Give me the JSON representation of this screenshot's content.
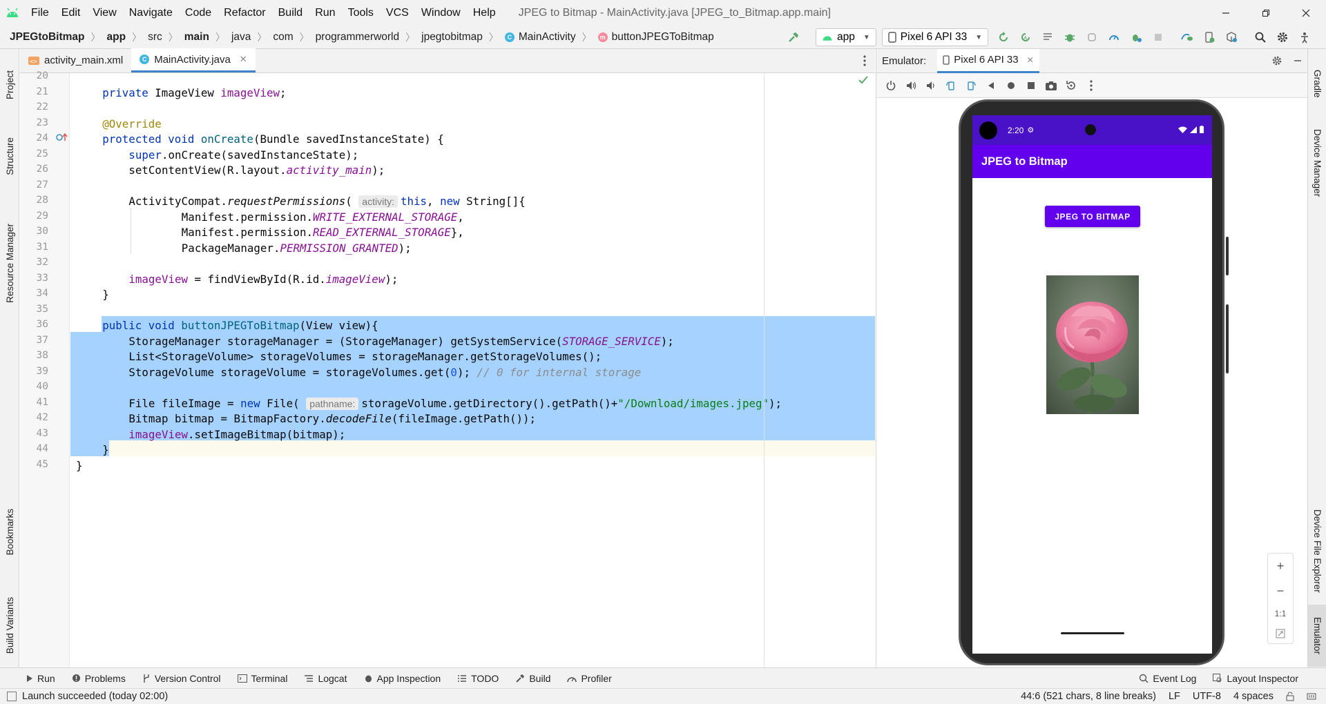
{
  "menubar": {
    "items": [
      "File",
      "Edit",
      "View",
      "Navigate",
      "Code",
      "Refactor",
      "Build",
      "Run",
      "Tools",
      "VCS",
      "Window",
      "Help"
    ],
    "window_title": "JPEG to Bitmap - MainActivity.java [JPEG_to_Bitmap.app.main]"
  },
  "breadcrumbs": [
    "JPEGtoBitmap",
    "app",
    "src",
    "main",
    "java",
    "com",
    "programmerworld",
    "jpegtobitmap",
    "MainActivity",
    "buttonJPEGToBitmap"
  ],
  "toolbar": {
    "run_config": "app",
    "device": "Pixel 6 API 33"
  },
  "left_tabs": [
    "Project",
    "Structure",
    "Resource Manager",
    "Bookmarks",
    "Build Variants"
  ],
  "right_tabs": [
    "Gradle",
    "Device Manager",
    "Device File Explorer",
    "Emulator"
  ],
  "editor_tabs": [
    {
      "label": "activity_main.xml",
      "icon": "xml-file-icon"
    },
    {
      "label": "MainActivity.java",
      "icon": "java-class-icon"
    }
  ],
  "line_numbers": [
    "20",
    "21",
    "22",
    "23",
    "24",
    "25",
    "26",
    "27",
    "28",
    "29",
    "30",
    "31",
    "32",
    "33",
    "34",
    "35",
    "36",
    "37",
    "38",
    "39",
    "40",
    "41",
    "42",
    "43",
    "44",
    "45"
  ],
  "code_hints": {
    "activity": "activity:",
    "pathname": "pathname:"
  },
  "emulator": {
    "label": "Emulator:",
    "tab": "Pixel 6 API 33",
    "phone_time": "2:20",
    "app_title": "JPEG to Bitmap",
    "button_label": "JPEG TO BITMAP",
    "zoom_label": "1:1"
  },
  "bottom_tools": [
    "Run",
    "Problems",
    "Version Control",
    "Terminal",
    "Logcat",
    "App Inspection",
    "TODO",
    "Build",
    "Profiler"
  ],
  "bottom_right_tools": [
    "Event Log",
    "Layout Inspector"
  ],
  "status": {
    "message": "Launch succeeded (today 02:00)",
    "position": "44:6 (521 chars, 8 line breaks)",
    "line_sep": "LF",
    "encoding": "UTF-8",
    "indent": "4 spaces"
  },
  "colors": {
    "accent": "#4083c9",
    "selection": "#a6d2ff",
    "app_primary": "#6200ee",
    "android_green": "#3ddc84"
  }
}
